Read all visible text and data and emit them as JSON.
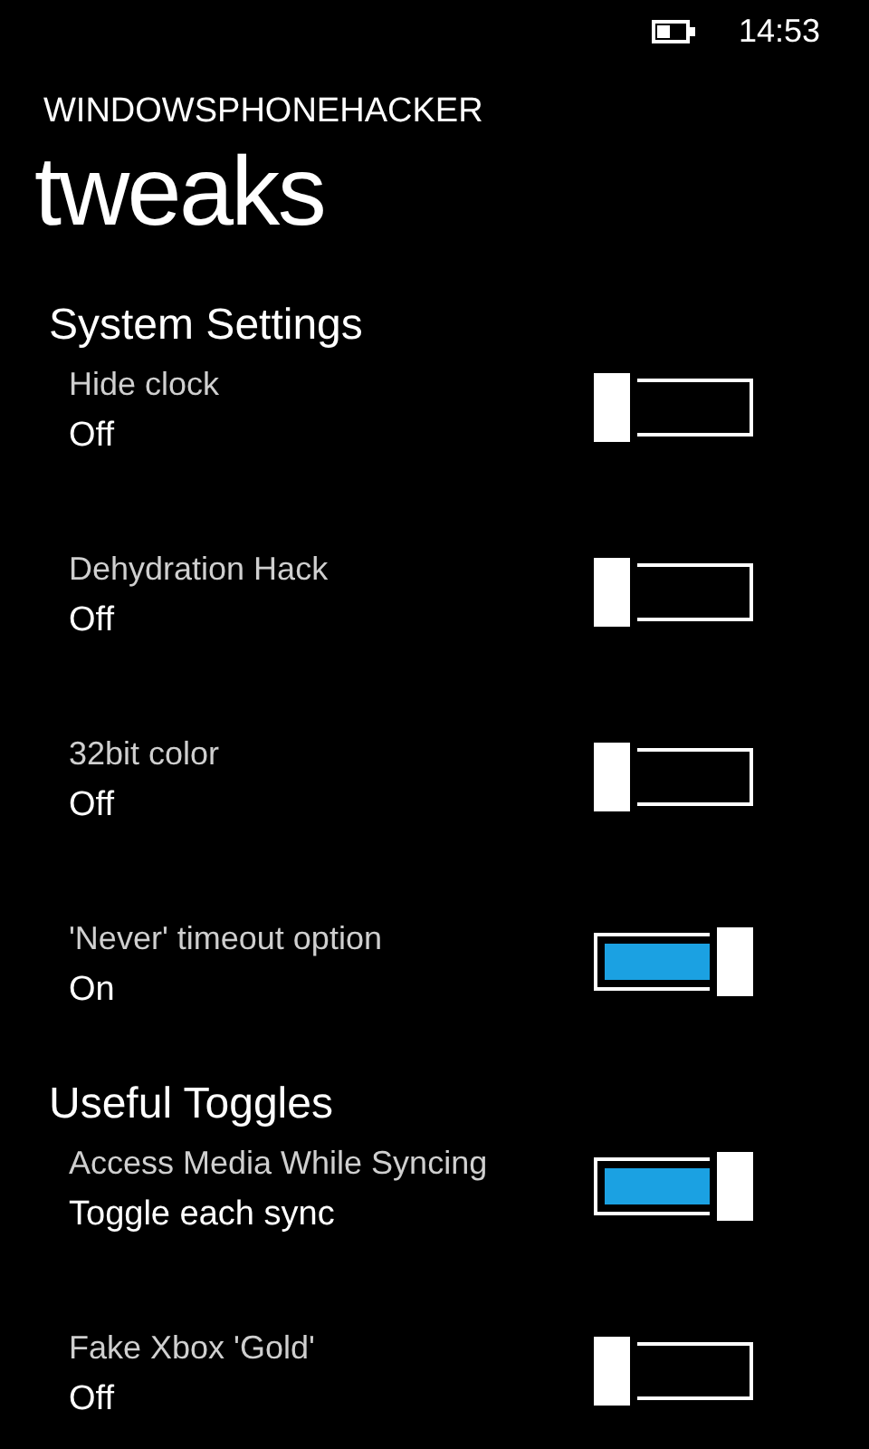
{
  "status_bar": {
    "time": "14:53"
  },
  "app_title": "WINDOWSPHONEHACKER",
  "page_title": "tweaks",
  "sections": [
    {
      "title": "System Settings",
      "items": [
        {
          "label": "Hide clock",
          "value": "Off",
          "on": false
        },
        {
          "label": "Dehydration Hack",
          "value": "Off",
          "on": false
        },
        {
          "label": "32bit color",
          "value": "Off",
          "on": false
        },
        {
          "label": "'Never' timeout option",
          "value": "On",
          "on": true
        }
      ]
    },
    {
      "title": "Useful Toggles",
      "items": [
        {
          "label": "Access Media While Syncing",
          "value": "Toggle each sync",
          "on": true
        },
        {
          "label": "Fake Xbox 'Gold'",
          "value": "Off",
          "on": false
        }
      ]
    }
  ]
}
